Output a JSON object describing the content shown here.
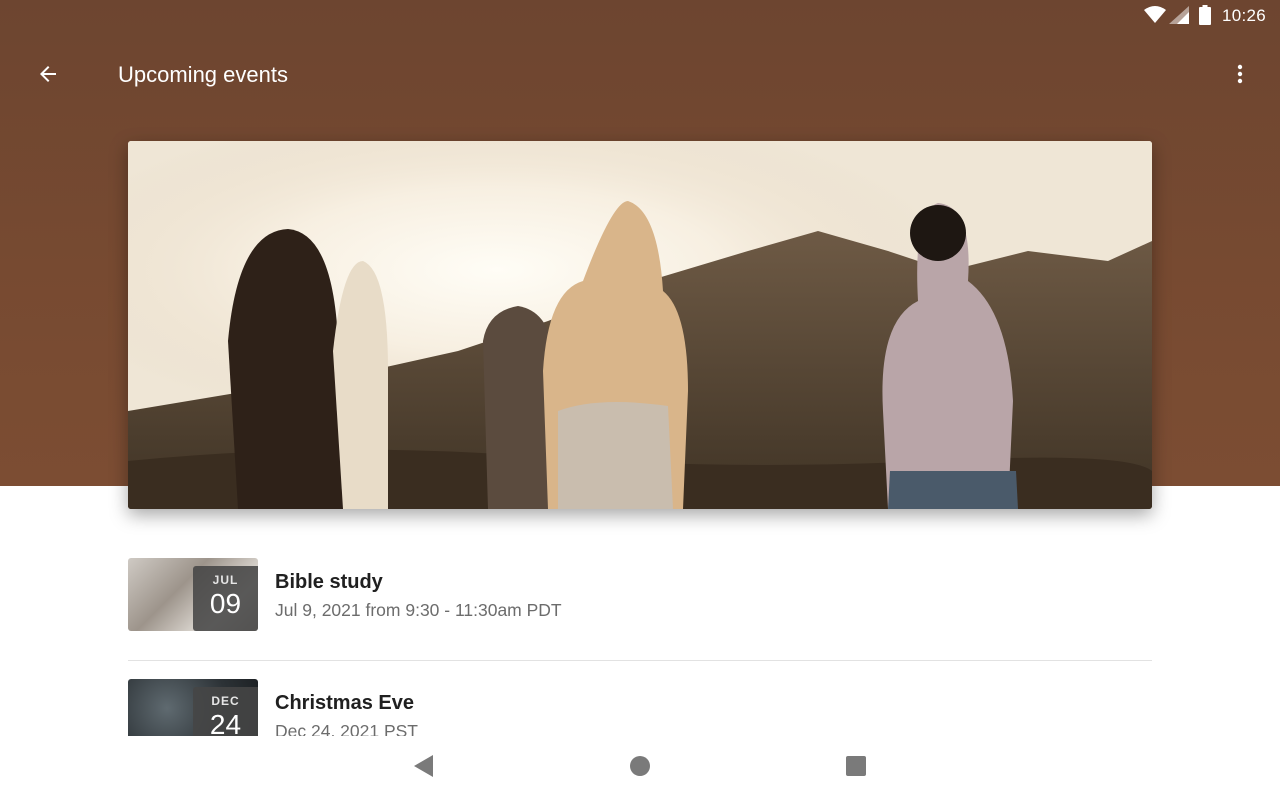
{
  "status_bar": {
    "time": "10:26",
    "icons": [
      "wifi-icon",
      "cell-signal-icon",
      "battery-icon"
    ]
  },
  "app_bar": {
    "title": "Upcoming events",
    "back_icon": "arrow-back-icon",
    "menu_icon": "more-vert-icon"
  },
  "colors": {
    "header_brown": "#774a31",
    "list_background": "#ffffff",
    "badge_background": "#464646"
  },
  "events": [
    {
      "month": "JUL",
      "day": "09",
      "title": "Bible study",
      "subtitle": "Jul 9, 2021 from 9:30 - 11:30am PDT"
    },
    {
      "month": "DEC",
      "day": "24",
      "title": "Christmas Eve",
      "subtitle": "Dec 24, 2021 PST"
    }
  ],
  "nav_bar": {
    "icons": [
      "back-triangle-icon",
      "home-circle-icon",
      "recents-square-icon"
    ]
  }
}
